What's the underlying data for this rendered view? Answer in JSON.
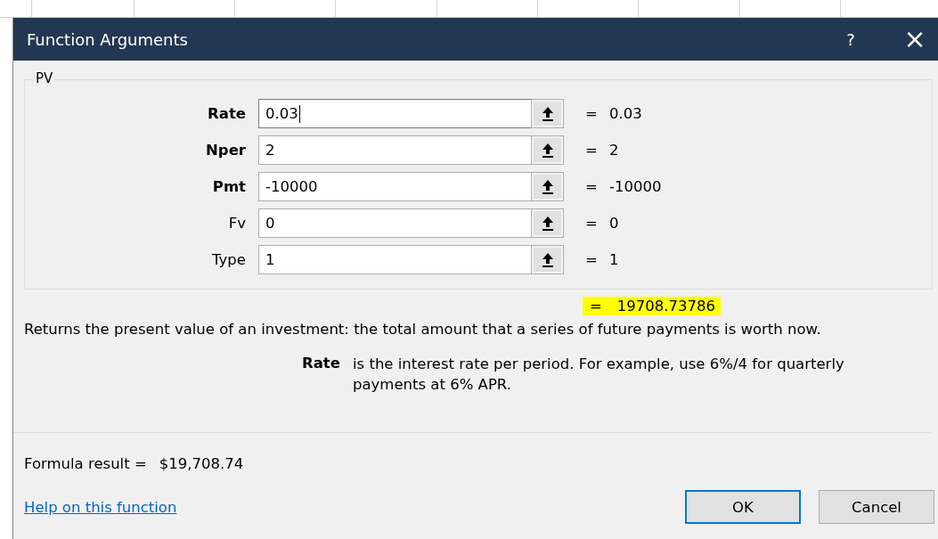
{
  "window": {
    "title": "Function Arguments",
    "help_button": "?",
    "close_button": "×"
  },
  "function_group": {
    "name": "PV",
    "arguments": [
      {
        "label": "Rate",
        "required": true,
        "value": "0.03",
        "focused": true,
        "result": "= 0.03"
      },
      {
        "label": "Nper",
        "required": true,
        "value": "2",
        "focused": false,
        "result": "= 2"
      },
      {
        "label": "Pmt",
        "required": true,
        "value": "-10000",
        "focused": false,
        "result": "= -10000"
      },
      {
        "label": "Fv",
        "required": false,
        "value": "0",
        "focused": false,
        "result": "= 0"
      },
      {
        "label": "Type",
        "required": false,
        "value": "1",
        "focused": false,
        "result": "= 1"
      }
    ]
  },
  "function_result": {
    "equals": "=",
    "value": "19708.73786",
    "highlighted": true
  },
  "description": "Returns the present value of an investment: the total amount that a series of future payments is worth now.",
  "argument_help": {
    "name": "Rate",
    "text": "is the interest rate per period. For example, use 6%/4 for quarterly payments at 6% APR."
  },
  "formula_result": {
    "label": "Formula result =",
    "value": "$19,708.74"
  },
  "help_link": "Help on this function",
  "buttons": [
    {
      "label": "OK",
      "default": true
    },
    {
      "label": "Cancel",
      "default": false
    }
  ]
}
